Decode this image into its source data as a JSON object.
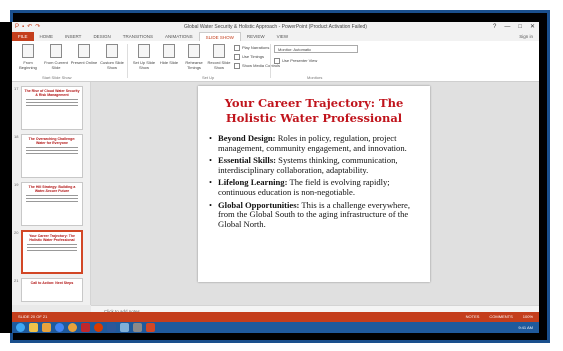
{
  "window": {
    "title": "Global Water Security & Holistic Approach - PowerPoint (Product Activation Failed)",
    "controls": [
      "?",
      "—",
      "□",
      "✕"
    ]
  },
  "ribbon_tabs": [
    "FILE",
    "HOME",
    "INSERT",
    "DESIGN",
    "TRANSITIONS",
    "ANIMATIONS",
    "SLIDE SHOW",
    "REVIEW",
    "VIEW"
  ],
  "active_tab": "SLIDE SHOW",
  "sign_in": "Sign in",
  "ribbon": {
    "buttons": [
      "From Beginning",
      "From Current Slide",
      "Present Online",
      "Custom Slide Show",
      "Set Up Slide Show",
      "Hide Slide",
      "Rehearse Timings",
      "Record Slide Show"
    ],
    "checks": [
      "Play Narrations",
      "Use Timings",
      "Show Media Controls"
    ],
    "monitor_label": "Monitor: Automatic",
    "presenter_view": "Use Presenter View",
    "groups": [
      "Start Slide Show",
      "Set Up",
      "Monitors"
    ]
  },
  "thumbnails": [
    {
      "num": "17",
      "title": "The Rise of Cloud Water Security & Risk Management"
    },
    {
      "num": "18",
      "title": "The Overarching Challenge: Water for Everyone"
    },
    {
      "num": "19",
      "title": "The Hill Strategy: Building a Water-Secure Future"
    },
    {
      "num": "20",
      "title": "Your Career Trajectory: The Holistic Water Professional",
      "selected": true
    },
    {
      "num": "21",
      "title": "Call to Action: Next Steps"
    }
  ],
  "slide": {
    "title": "Your Career Trajectory: The Holistic Water Professional",
    "bullets": [
      {
        "label": "Beyond Design:",
        "text": " Roles in policy, regulation, project management, community engagement, and innovation."
      },
      {
        "label": "Essential Skills:",
        "text": " Systems thinking, communication, interdisciplinary collaboration, adaptability."
      },
      {
        "label": "Lifelong Learning:",
        "text": " The field is evolving rapidly; continuous education is non-negotiable."
      },
      {
        "label": "Global Opportunities:",
        "text": " This is a challenge everywhere, from the Global South to the aging infrastructure of the Global North."
      }
    ]
  },
  "notes_placeholder": "Click to add notes",
  "status": {
    "left": "SLIDE 20 OF 21",
    "right": [
      "NOTES",
      "COMMENTS",
      "100%"
    ]
  },
  "taskbar_time": "9:41 AM",
  "colors": {
    "accent": "#c43e1c",
    "title_red": "#c0141c",
    "taskbar": "#1f5a9c",
    "frame": "#1a4f8c"
  }
}
